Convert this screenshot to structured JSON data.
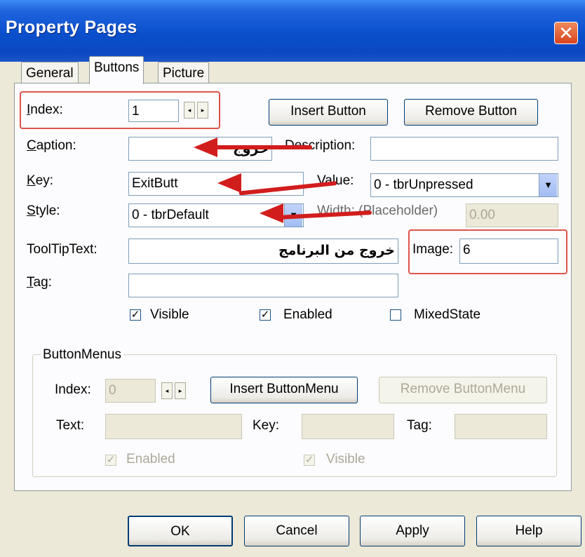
{
  "window": {
    "title": "Property Pages",
    "close_glyph": "✕"
  },
  "tabs": [
    {
      "label": "General"
    },
    {
      "label": "Buttons"
    },
    {
      "label": "Picture"
    }
  ],
  "fields": {
    "index": {
      "label": "Index:",
      "value": "1"
    },
    "caption": {
      "label": "Caption:",
      "value": "خروج"
    },
    "key": {
      "label": "Key:",
      "value": "ExitButt"
    },
    "style": {
      "label": "Style:",
      "value": "0 - tbrDefault"
    },
    "tooltip": {
      "label": "ToolTipText:",
      "value": "خروج من البرنامج"
    },
    "tag": {
      "label": "Tag:",
      "value": ""
    },
    "description": {
      "label": "Description:",
      "value": ""
    },
    "value": {
      "label": "Value:",
      "value": "0 - tbrUnpressed"
    },
    "width": {
      "label": "Width: (Placeholder)",
      "value": "0.00"
    },
    "image": {
      "label": "Image:",
      "value": "6"
    }
  },
  "buttons": {
    "insert": "Insert Button",
    "remove": "Remove Button"
  },
  "checkboxes": {
    "visible": {
      "label": "Visible",
      "checked": true
    },
    "enabled": {
      "label": "Enabled",
      "checked": true
    },
    "mixed": {
      "label": "MixedState",
      "checked": false
    }
  },
  "buttonmenus": {
    "title": "ButtonMenus",
    "index_label": "Index:",
    "index_value": "0",
    "insert_label": "Insert ButtonMenu",
    "remove_label": "Remove ButtonMenu",
    "text_label": "Text:",
    "key_label": "Key:",
    "tag_label": "Tag:",
    "enabled_label": "Enabled",
    "visible_label": "Visible"
  },
  "footer": {
    "ok": "OK",
    "cancel": "Cancel",
    "apply": "Apply",
    "help": "Help"
  },
  "colors": {
    "titlebar": "#0a4fcc",
    "annotation_red": "#d21d1d",
    "highlight_box": "#e0534a"
  }
}
